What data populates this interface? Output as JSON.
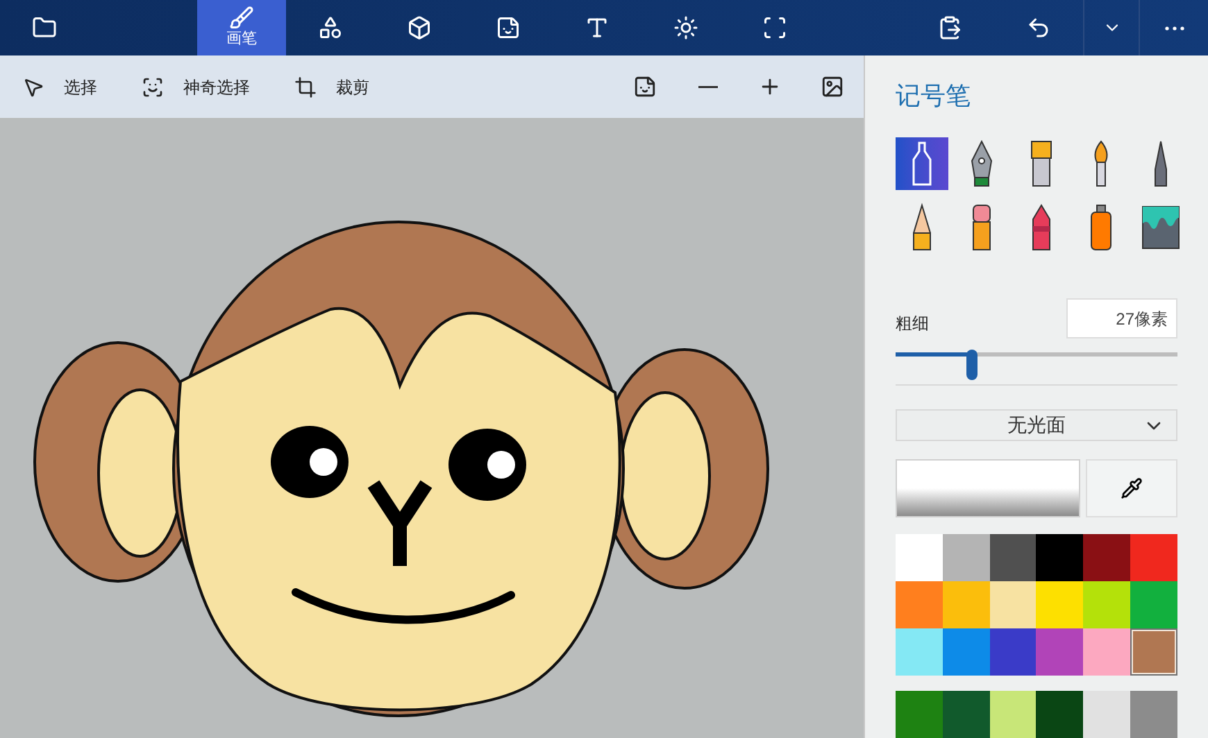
{
  "top_tabs": [
    {
      "kind": "brush",
      "label": "画笔",
      "selected": true
    },
    {
      "kind": "shapes",
      "selected": false
    },
    {
      "kind": "cube",
      "selected": false
    },
    {
      "kind": "sticker",
      "selected": false
    },
    {
      "kind": "text",
      "selected": false
    },
    {
      "kind": "effects",
      "selected": false
    },
    {
      "kind": "canvas",
      "selected": false
    }
  ],
  "toolbar": [
    {
      "kind": "select",
      "label": "选择"
    },
    {
      "kind": "magic",
      "label": "神奇选择"
    },
    {
      "kind": "crop",
      "label": "裁剪"
    }
  ],
  "panel": {
    "title": "记号笔",
    "brushes": [
      {
        "kind": "marker",
        "selected": true
      },
      {
        "kind": "pen",
        "selected": false
      },
      {
        "kind": "oil",
        "selected": false
      },
      {
        "kind": "water",
        "selected": false
      },
      {
        "kind": "pixel",
        "selected": false
      },
      {
        "kind": "pencil",
        "selected": false
      },
      {
        "kind": "eraser",
        "selected": false
      },
      {
        "kind": "crayon",
        "selected": false
      },
      {
        "kind": "spray",
        "selected": false
      },
      {
        "kind": "fill",
        "selected": false
      }
    ],
    "thickness": {
      "label": "粗细",
      "value": "27像素",
      "level": 0.27
    },
    "finish": "无光面",
    "colors": [
      {
        "color": "#ffffff",
        "selected": false
      },
      {
        "color": "#b4b4b4",
        "selected": false
      },
      {
        "color": "#505050",
        "selected": false
      },
      {
        "color": "#000000",
        "selected": false
      },
      {
        "color": "#8a1014",
        "selected": false
      },
      {
        "color": "#f0281e",
        "selected": false
      },
      {
        "color": "#ff7f1e",
        "selected": false
      },
      {
        "color": "#fbbe0c",
        "selected": false
      },
      {
        "color": "#f7e2a2",
        "selected": false
      },
      {
        "color": "#fde000",
        "selected": false
      },
      {
        "color": "#b4e10a",
        "selected": false
      },
      {
        "color": "#12b03e",
        "selected": false
      },
      {
        "color": "#84e8f4",
        "selected": false
      },
      {
        "color": "#0d8be8",
        "selected": false
      },
      {
        "color": "#3a3bc8",
        "selected": false
      },
      {
        "color": "#b144b8",
        "selected": false
      },
      {
        "color": "#fca8c0",
        "selected": false
      },
      {
        "color": "#b07752",
        "selected": true
      },
      {
        "color": "#1e8212",
        "selected": false
      },
      {
        "color": "#115a2c",
        "selected": false
      },
      {
        "color": "#c8e678",
        "selected": false
      },
      {
        "color": "#0a4614",
        "selected": false
      },
      {
        "color": "#e1e1e1",
        "selected": false
      },
      {
        "color": "#8c8c8c",
        "selected": false
      }
    ]
  }
}
